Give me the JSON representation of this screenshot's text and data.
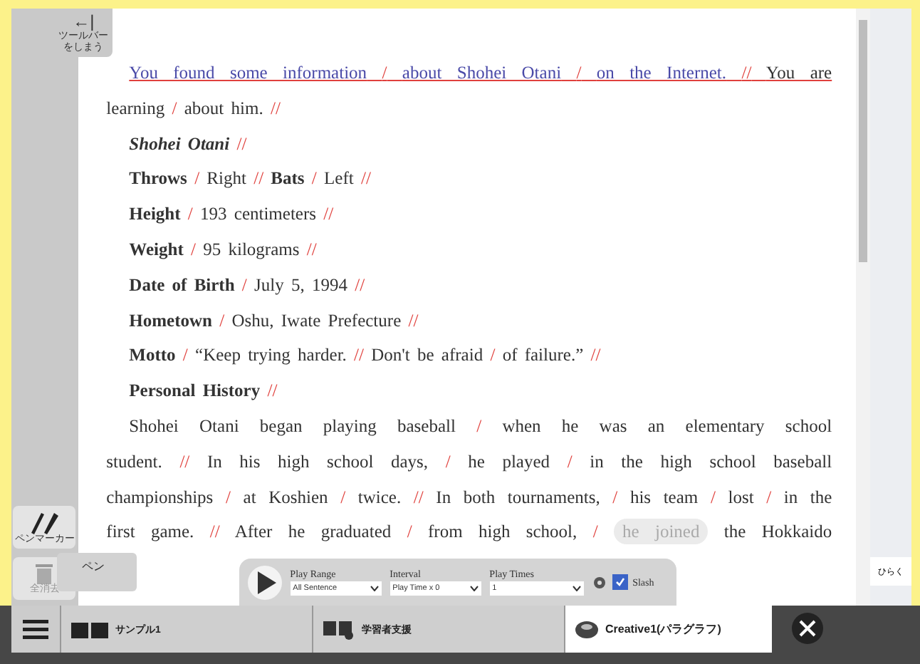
{
  "toolbar_toggle": {
    "arrow": "←|",
    "label": "ツールバーをしまう"
  },
  "lines": [
    {
      "indent": true,
      "justify": true,
      "segments": [
        {
          "kind": "current",
          "text": "You found some information"
        },
        {
          "kind": "slash",
          "text": "/"
        },
        {
          "kind": "current",
          "text": "about Shohei Otani"
        },
        {
          "kind": "slash",
          "text": "/"
        },
        {
          "kind": "current",
          "text": "on the Internet."
        },
        {
          "kind": "slash",
          "text": "//"
        },
        {
          "kind": "text",
          "text": "You are"
        }
      ]
    },
    {
      "indent": false,
      "justify": false,
      "segments": [
        {
          "kind": "text",
          "text": "learning"
        },
        {
          "kind": "slash",
          "text": "/"
        },
        {
          "kind": "text",
          "text": "about him."
        },
        {
          "kind": "slash",
          "text": "//"
        }
      ]
    },
    {
      "indent": true,
      "justify": false,
      "segments": [
        {
          "kind": "bolditalic",
          "text": "Shohei Otani"
        },
        {
          "kind": "slash",
          "text": "//"
        }
      ]
    },
    {
      "indent": true,
      "justify": false,
      "segments": [
        {
          "kind": "bold",
          "text": "Throws"
        },
        {
          "kind": "slash",
          "text": "/"
        },
        {
          "kind": "text",
          "text": "Right"
        },
        {
          "kind": "slash",
          "text": "//"
        },
        {
          "kind": "bold",
          "text": "Bats"
        },
        {
          "kind": "slash",
          "text": "/"
        },
        {
          "kind": "text",
          "text": "Left"
        },
        {
          "kind": "slash",
          "text": "//"
        }
      ]
    },
    {
      "indent": true,
      "justify": false,
      "segments": [
        {
          "kind": "bold",
          "text": "Height"
        },
        {
          "kind": "slash",
          "text": "/"
        },
        {
          "kind": "text",
          "text": "193 centimeters"
        },
        {
          "kind": "slash",
          "text": "//"
        }
      ]
    },
    {
      "indent": true,
      "justify": false,
      "segments": [
        {
          "kind": "bold",
          "text": "Weight"
        },
        {
          "kind": "slash",
          "text": "/"
        },
        {
          "kind": "text",
          "text": "95 kilograms"
        },
        {
          "kind": "slash",
          "text": "//"
        }
      ]
    },
    {
      "indent": true,
      "justify": false,
      "segments": [
        {
          "kind": "bold",
          "text": "Date of Birth"
        },
        {
          "kind": "slash",
          "text": "/"
        },
        {
          "kind": "text",
          "text": "July 5, 1994"
        },
        {
          "kind": "slash",
          "text": "//"
        }
      ]
    },
    {
      "indent": true,
      "justify": false,
      "segments": [
        {
          "kind": "bold",
          "text": "Hometown"
        },
        {
          "kind": "slash",
          "text": "/"
        },
        {
          "kind": "text",
          "text": "Oshu, Iwate Prefecture"
        },
        {
          "kind": "slash",
          "text": "//"
        }
      ]
    },
    {
      "indent": true,
      "justify": false,
      "segments": [
        {
          "kind": "bold",
          "text": "Motto"
        },
        {
          "kind": "slash",
          "text": "/"
        },
        {
          "kind": "text",
          "text": "“Keep trying harder."
        },
        {
          "kind": "slash",
          "text": "//"
        },
        {
          "kind": "text",
          "text": "Don't be afraid"
        },
        {
          "kind": "slash",
          "text": "/"
        },
        {
          "kind": "text",
          "text": "of failure.”"
        },
        {
          "kind": "slash",
          "text": "//"
        }
      ]
    },
    {
      "indent": true,
      "justify": false,
      "segments": [
        {
          "kind": "bold",
          "text": "Personal History"
        },
        {
          "kind": "slash",
          "text": "//"
        }
      ]
    },
    {
      "indent": true,
      "justify": true,
      "segments": [
        {
          "kind": "text",
          "text": "Shohei Otani began playing baseball"
        },
        {
          "kind": "slash",
          "text": "/"
        },
        {
          "kind": "text",
          "text": "when he was an elementary school"
        }
      ]
    },
    {
      "indent": false,
      "justify": true,
      "segments": [
        {
          "kind": "text",
          "text": "student."
        },
        {
          "kind": "slash",
          "text": "//"
        },
        {
          "kind": "text",
          "text": "In his high school days,"
        },
        {
          "kind": "slash",
          "text": "/"
        },
        {
          "kind": "text",
          "text": "he played"
        },
        {
          "kind": "slash",
          "text": "/"
        },
        {
          "kind": "text",
          "text": "in the high school baseball"
        }
      ]
    },
    {
      "indent": false,
      "justify": true,
      "segments": [
        {
          "kind": "text",
          "text": "championships"
        },
        {
          "kind": "slash",
          "text": "/"
        },
        {
          "kind": "text",
          "text": "at Koshien"
        },
        {
          "kind": "slash",
          "text": "/"
        },
        {
          "kind": "text",
          "text": "twice."
        },
        {
          "kind": "slash",
          "text": "//"
        },
        {
          "kind": "text",
          "text": "In both tournaments,"
        },
        {
          "kind": "slash",
          "text": "/"
        },
        {
          "kind": "text",
          "text": "his team"
        },
        {
          "kind": "slash",
          "text": "/"
        },
        {
          "kind": "text",
          "text": "lost"
        },
        {
          "kind": "slash",
          "text": "/"
        },
        {
          "kind": "text",
          "text": "in the"
        }
      ]
    },
    {
      "indent": false,
      "justify": true,
      "segments": [
        {
          "kind": "text",
          "text": "first game."
        },
        {
          "kind": "slash",
          "text": "//"
        },
        {
          "kind": "text",
          "text": "After he graduated"
        },
        {
          "kind": "slash",
          "text": "/"
        },
        {
          "kind": "text",
          "text": "from high school,"
        },
        {
          "kind": "slash",
          "text": "/"
        },
        {
          "kind": "bubble",
          "text": "he joined"
        },
        {
          "kind": "text",
          "text": "the Hokkaido"
        }
      ]
    }
  ],
  "tools": [
    {
      "kind": "pen",
      "label": "ペンマーカー"
    },
    {
      "kind": "trash",
      "label": "全消去"
    }
  ],
  "pen_popup": {
    "label": "ペン"
  },
  "side_panel": {
    "button": "ひらく"
  },
  "player": {
    "range_label": "Play Range",
    "range_value": "All Sentence",
    "interval_label": "Interval",
    "interval_value": "Play Time x 0",
    "times_label": "Play Times",
    "times_value": "1",
    "slash": {
      "label": "Slash",
      "checked": true
    }
  },
  "tabs": [
    {
      "label": "サンプル1",
      "selected": false
    },
    {
      "label": "学習者支援",
      "selected": false
    },
    {
      "label": "Creative1(パラグラフ)",
      "selected": true
    }
  ]
}
